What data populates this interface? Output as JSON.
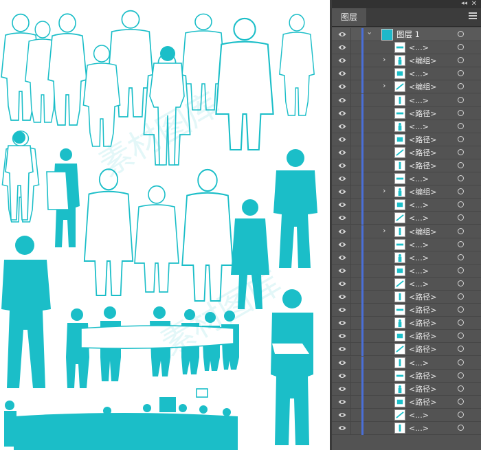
{
  "colors": {
    "silhouette": "#1bbec8",
    "panel_bg": "#535353",
    "layer_color": "#4a6fd8"
  },
  "panel": {
    "tab_label": "图层",
    "collapse_glyph": "◂◂",
    "close_glyph": "✕",
    "menu_icon": "hamburger-menu-icon"
  },
  "canvas": {
    "watermark": "素材图库"
  },
  "layers": {
    "top": {
      "name": "图层 1",
      "expanded": true
    },
    "items": [
      {
        "name": "<...>",
        "expandable": false
      },
      {
        "name": "<编组>",
        "expandable": true
      },
      {
        "name": "<...>",
        "expandable": false
      },
      {
        "name": "<编组>",
        "expandable": true
      },
      {
        "name": "<...>",
        "expandable": false
      },
      {
        "name": "<路径>",
        "expandable": false
      },
      {
        "name": "<...>",
        "expandable": false
      },
      {
        "name": "<路径>",
        "expandable": false
      },
      {
        "name": "<路径>",
        "expandable": false
      },
      {
        "name": "<路径>",
        "expandable": false
      },
      {
        "name": "<...>",
        "expandable": false
      },
      {
        "name": "<编组>",
        "expandable": true
      },
      {
        "name": "<...>",
        "expandable": false
      },
      {
        "name": "<...>",
        "expandable": false
      },
      {
        "name": "<编组>",
        "expandable": true
      },
      {
        "name": "<...>",
        "expandable": false
      },
      {
        "name": "<...>",
        "expandable": false
      },
      {
        "name": "<...>",
        "expandable": false
      },
      {
        "name": "<...>",
        "expandable": false
      },
      {
        "name": "<路径>",
        "expandable": false
      },
      {
        "name": "<路径>",
        "expandable": false
      },
      {
        "name": "<路径>",
        "expandable": false
      },
      {
        "name": "<路径>",
        "expandable": false
      },
      {
        "name": "<路径>",
        "expandable": false
      },
      {
        "name": "<...>",
        "expandable": false
      },
      {
        "name": "<路径>",
        "expandable": false
      },
      {
        "name": "<路径>",
        "expandable": false
      },
      {
        "name": "<路径>",
        "expandable": false
      },
      {
        "name": "<...>",
        "expandable": false
      },
      {
        "name": "<...>",
        "expandable": false
      }
    ]
  }
}
